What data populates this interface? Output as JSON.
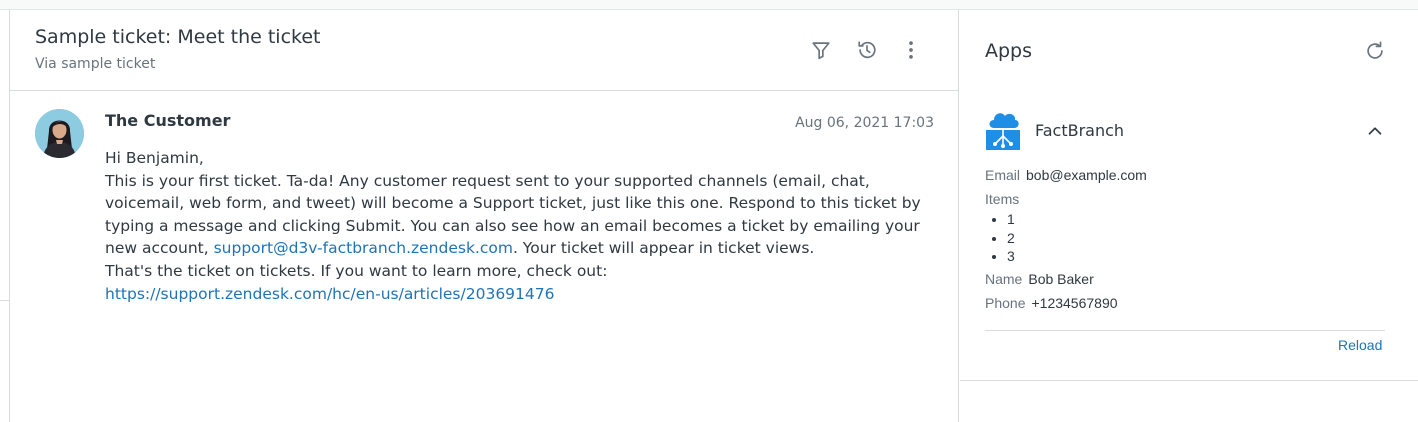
{
  "ticket": {
    "title": "Sample ticket: Meet the ticket",
    "via": "Via sample ticket",
    "actions": [
      {
        "icon": "filter-icon"
      },
      {
        "icon": "history-icon"
      },
      {
        "icon": "more-vertical-icon"
      }
    ]
  },
  "message": {
    "author": "The Customer",
    "timestamp": "Aug 06, 2021 17:03",
    "greeting": "Hi Benjamin,",
    "body_part1": "This is your first ticket. Ta-da! Any customer request sent to your supported channels (email, chat, voicemail, web form, and tweet) will become a Support ticket, just like this one. Respond to this ticket by typing a message and clicking Submit. You can also see how an email becomes a ticket by emailing your new account, ",
    "email_link": "support@d3v-factbranch.zendesk.com",
    "body_part2": ". Your ticket will appear in ticket views.",
    "closing": "That's the ticket on tickets. If you want to learn more, check out:",
    "article_link": "https://support.zendesk.com/hc/en-us/articles/203691476"
  },
  "apps": {
    "title": "Apps",
    "app": {
      "name": "FactBranch",
      "email_label": "Email",
      "email_value": "bob@example.com",
      "items_label": "Items",
      "items": [
        "1",
        "2",
        "3"
      ],
      "name_label": "Name",
      "name_value": "Bob Baker",
      "phone_label": "Phone",
      "phone_value": "+1234567890",
      "reload_label": "Reload"
    }
  },
  "colors": {
    "link": "#1f73b7",
    "logo": "#1f8fe5",
    "text": "#2f3941",
    "muted": "#68737d"
  }
}
